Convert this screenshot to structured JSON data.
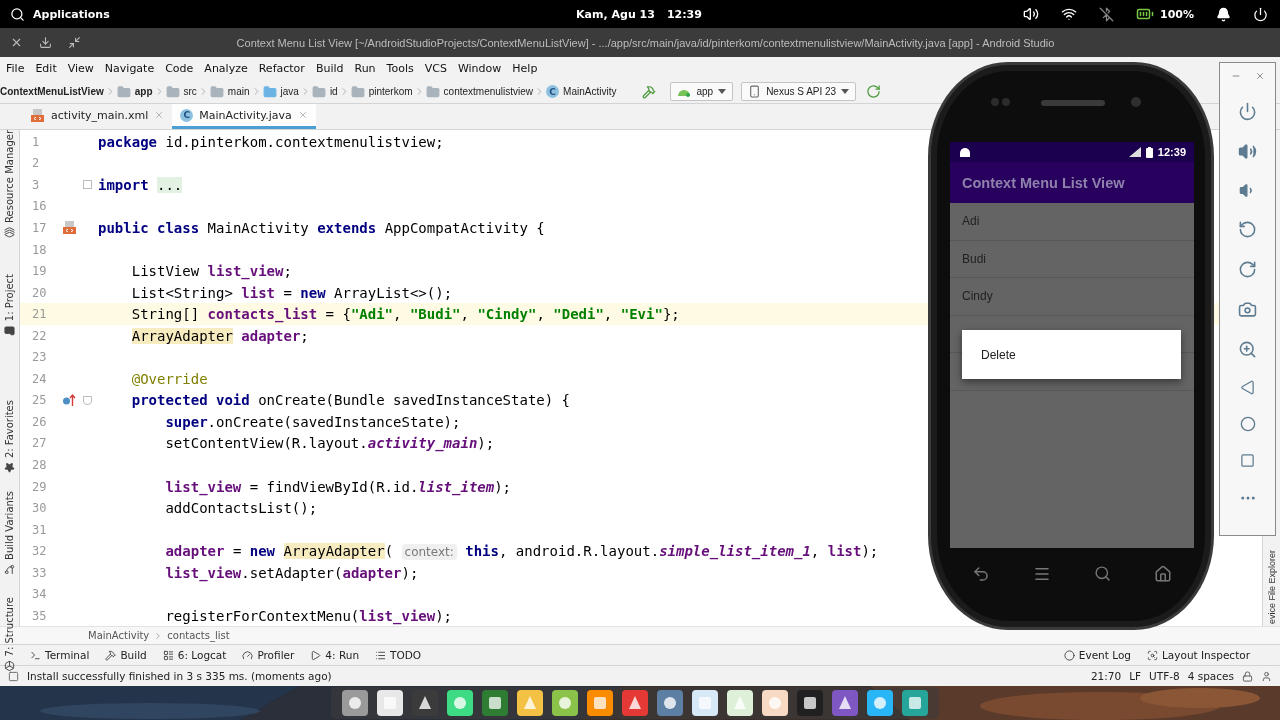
{
  "system_bar": {
    "menu_label": "Applications",
    "date": "Kam, Agu 13",
    "time": "12:39",
    "battery": "100%"
  },
  "window": {
    "title": "Context Menu List View [~/AndroidStudioProjects/ContextMenuListView] - .../app/src/main/java/id/pinterkom/contextmenulistview/MainActivity.java [app] - Android Studio"
  },
  "menu": [
    "File",
    "Edit",
    "View",
    "Navigate",
    "Code",
    "Analyze",
    "Refactor",
    "Build",
    "Run",
    "Tools",
    "VCS",
    "Window",
    "Help"
  ],
  "navigation": [
    {
      "label": "ContextMenuListView",
      "kind": "project"
    },
    {
      "label": "app",
      "kind": "module"
    },
    {
      "label": "src",
      "kind": "folder"
    },
    {
      "label": "main",
      "kind": "folder"
    },
    {
      "label": "java",
      "kind": "source"
    },
    {
      "label": "id",
      "kind": "package"
    },
    {
      "label": "pinterkom",
      "kind": "package"
    },
    {
      "label": "contextmenulistview",
      "kind": "package"
    },
    {
      "label": "MainActivity",
      "kind": "class",
      "badge": "C"
    }
  ],
  "run_config": "app",
  "device": "Nexus S API 23",
  "tabs": [
    {
      "label": "activity_main.xml",
      "kind": "xml",
      "selected": false
    },
    {
      "label": "MainActivity.java",
      "kind": "class",
      "badge": "C",
      "selected": true
    }
  ],
  "left_tool_windows": [
    {
      "label": "Resource Manager",
      "kind": "resources"
    },
    {
      "label": "1: Project",
      "kind": "project"
    },
    {
      "label": "2: Favorites",
      "kind": "favorites"
    },
    {
      "label": "Build Variants",
      "kind": "variants"
    },
    {
      "label": "7: Structure",
      "kind": "structure"
    }
  ],
  "right_tool_window": "evice File Explorer",
  "code_lines": [
    {
      "n": "1",
      "tokens": [
        {
          "kind": "keyword",
          "text": "package"
        },
        {
          "kind": "plain",
          "text": " id.pinterkom.contextmenulistview;"
        }
      ]
    },
    {
      "n": "2"
    },
    {
      "n": "3",
      "collapsed": true,
      "tokens": [
        {
          "kind": "keyword",
          "text": "import"
        },
        {
          "kind": "folded",
          "text": " ..."
        }
      ]
    },
    {
      "n": "16"
    },
    {
      "n": "17",
      "kind": "class_declaration",
      "tokens": [
        {
          "kind": "keyword",
          "text": "public class"
        },
        {
          "kind": "plain",
          "text": " MainActivity "
        },
        {
          "kind": "keyword",
          "text": "extends"
        },
        {
          "kind": "plain",
          "text": " AppCompatActivity {"
        }
      ]
    },
    {
      "n": "18"
    },
    {
      "n": "19",
      "tokens": [
        {
          "kind": "plain",
          "text": "    ListView "
        },
        {
          "kind": "field",
          "text": "list_view"
        },
        {
          "kind": "plain",
          "text": ";"
        }
      ]
    },
    {
      "n": "20",
      "tokens": [
        {
          "kind": "plain",
          "text": "    List<String> "
        },
        {
          "kind": "field",
          "text": "list"
        },
        {
          "kind": "plain",
          "text": " = "
        },
        {
          "kind": "keyword",
          "text": "new"
        },
        {
          "kind": "plain",
          "text": " ArrayList<>();"
        }
      ]
    },
    {
      "n": "21",
      "current": true,
      "tokens": [
        {
          "kind": "plain",
          "text": "    String[] "
        },
        {
          "kind": "field",
          "text": "contacts_list"
        },
        {
          "kind": "plain",
          "text": " = {"
        },
        {
          "kind": "string",
          "text": "\"Adi\""
        },
        {
          "kind": "plain",
          "text": ", "
        },
        {
          "kind": "string",
          "text": "\"Budi\""
        },
        {
          "kind": "plain",
          "text": ", "
        },
        {
          "kind": "string",
          "text": "\"Cindy\""
        },
        {
          "kind": "plain",
          "text": ", "
        },
        {
          "kind": "string",
          "text": "\"Dedi\""
        },
        {
          "kind": "plain",
          "text": ", "
        },
        {
          "kind": "string",
          "text": "\"Evi\""
        },
        {
          "kind": "plain",
          "text": "};"
        }
      ]
    },
    {
      "n": "22",
      "tokens": [
        {
          "kind": "highlighted",
          "text": "    ArrayAdapter"
        },
        {
          "kind": "field",
          "text": " adapter"
        },
        {
          "kind": "plain",
          "text": ";"
        }
      ]
    },
    {
      "n": "23"
    },
    {
      "n": "24",
      "tokens": [
        {
          "kind": "annotation",
          "text": "    @Override"
        }
      ]
    },
    {
      "n": "25",
      "kind": "override",
      "collapsed": false,
      "tokens": [
        {
          "kind": "keyword",
          "text": "    protected void"
        },
        {
          "kind": "plain",
          "text": " onCreate(Bundle savedInstanceState) {"
        }
      ]
    },
    {
      "n": "26",
      "tokens": [
        {
          "kind": "keyword",
          "text": "        super"
        },
        {
          "kind": "plain",
          "text": ".onCreate(savedInstanceState);"
        }
      ]
    },
    {
      "n": "27",
      "tokens": [
        {
          "kind": "plain",
          "text": "        setContentView(R.layout."
        },
        {
          "kind": "static",
          "text": "activity_main"
        },
        {
          "kind": "plain",
          "text": ");"
        }
      ]
    },
    {
      "n": "28"
    },
    {
      "n": "29",
      "tokens": [
        {
          "kind": "field",
          "text": "        list_view"
        },
        {
          "kind": "plain",
          "text": " = findViewById(R.id."
        },
        {
          "kind": "static",
          "text": "list_item"
        },
        {
          "kind": "plain",
          "text": ");"
        }
      ]
    },
    {
      "n": "30",
      "tokens": [
        {
          "kind": "plain",
          "text": "        addContactsList();"
        }
      ]
    },
    {
      "n": "31"
    },
    {
      "n": "32",
      "tokens": [
        {
          "kind": "field",
          "text": "        adapter"
        },
        {
          "kind": "plain",
          "text": " = "
        },
        {
          "kind": "keyword",
          "text": "new"
        },
        {
          "kind": "highlighted",
          "text": " ArrayAdapter"
        },
        {
          "kind": "plain",
          "text": "("
        },
        {
          "kind": "hint",
          "text": " context:"
        },
        {
          "kind": "keyword",
          "text": " this"
        },
        {
          "kind": "plain",
          "text": ", android.R.layout."
        },
        {
          "kind": "static",
          "text": "simple_list_item_1"
        },
        {
          "kind": "plain",
          "text": ", "
        },
        {
          "kind": "field",
          "text": "list"
        },
        {
          "kind": "plain",
          "text": ");"
        }
      ]
    },
    {
      "n": "33",
      "tokens": [
        {
          "kind": "field",
          "text": "        list_view"
        },
        {
          "kind": "plain",
          "text": ".setAdapter("
        },
        {
          "kind": "field",
          "text": "adapter"
        },
        {
          "kind": "plain",
          "text": ");"
        }
      ]
    },
    {
      "n": "34"
    },
    {
      "n": "35",
      "tokens": [
        {
          "kind": "plain",
          "text": "        registerForContextMenu("
        },
        {
          "kind": "field",
          "text": "list_view"
        },
        {
          "kind": "plain",
          "text": ");"
        }
      ]
    }
  ],
  "editor_breadcrumb": [
    "MainActivity",
    "contacts_list"
  ],
  "tool_windows": [
    {
      "label": "Terminal",
      "kind": "terminal"
    },
    {
      "label": "Build",
      "kind": "build"
    },
    {
      "label": "6: Logcat",
      "kind": "logcat"
    },
    {
      "label": "Profiler",
      "kind": "profiler"
    },
    {
      "label": "4: Run",
      "kind": "run"
    },
    {
      "label": "TODO",
      "kind": "todo"
    }
  ],
  "tool_windows_right": [
    {
      "label": "Event Log",
      "kind": "events"
    },
    {
      "label": "Layout Inspector",
      "kind": "inspector"
    }
  ],
  "status_bar": {
    "message": "Install successfully finished in 3 s 335 ms. (moments ago)",
    "position": "21:70",
    "line_separator": "LF",
    "encoding": "UTF-8",
    "indent": "4 spaces"
  },
  "emulator": {
    "time": "12:39",
    "app_title": "Context Menu List View",
    "list_items": [
      "Adi",
      "Budi",
      "Cindy"
    ],
    "context_menu": [
      "Delete"
    ]
  }
}
